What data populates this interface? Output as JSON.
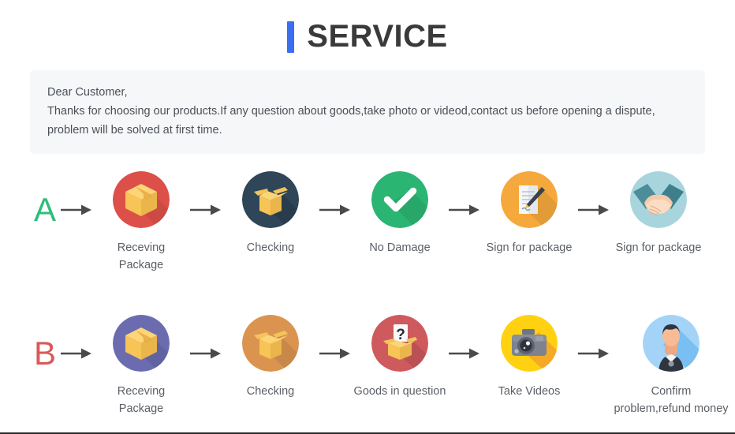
{
  "header": {
    "title": "SERVICE",
    "accent_color": "#3b6ef0"
  },
  "notice": {
    "line1": "Dear Customer,",
    "line2": "Thanks for choosing our products.If any question about goods,take photo or videod,contact us before opening a dispute,",
    "line3": "problem will be solved at first time."
  },
  "flows": [
    {
      "letter": "A",
      "letter_color": "#2fbd7c",
      "steps": [
        {
          "icon": "package-box-icon",
          "label": "Receving Package",
          "circle_color": "#dd4f49"
        },
        {
          "icon": "open-box-icon",
          "label": "Checking",
          "circle_color": "#2f4558"
        },
        {
          "icon": "checkmark-icon",
          "label": "No Damage",
          "circle_color": "#2bb573"
        },
        {
          "icon": "sign-document-icon",
          "label": "Sign for package",
          "circle_color": "#f5a93c"
        },
        {
          "icon": "handshake-icon",
          "label": "Sign for package",
          "circle_color": "#a8d5dd"
        }
      ]
    },
    {
      "letter": "B",
      "letter_color": "#d9595a",
      "steps": [
        {
          "icon": "package-box-icon",
          "label": "Receving Package",
          "circle_color": "#6b6cb0"
        },
        {
          "icon": "open-box-icon",
          "label": "Checking",
          "circle_color": "#db9450"
        },
        {
          "icon": "question-box-icon",
          "label": "Goods in question",
          "circle_color": "#cf5a5e"
        },
        {
          "icon": "camera-icon",
          "label": "Take Videos",
          "circle_color": "#ffd110"
        },
        {
          "icon": "support-agent-icon",
          "label": "Confirm problem,refund money",
          "circle_color": "#a3d4f7"
        }
      ]
    }
  ],
  "arrow": {
    "name": "arrow-right-icon",
    "color": "#4a4a4a"
  }
}
